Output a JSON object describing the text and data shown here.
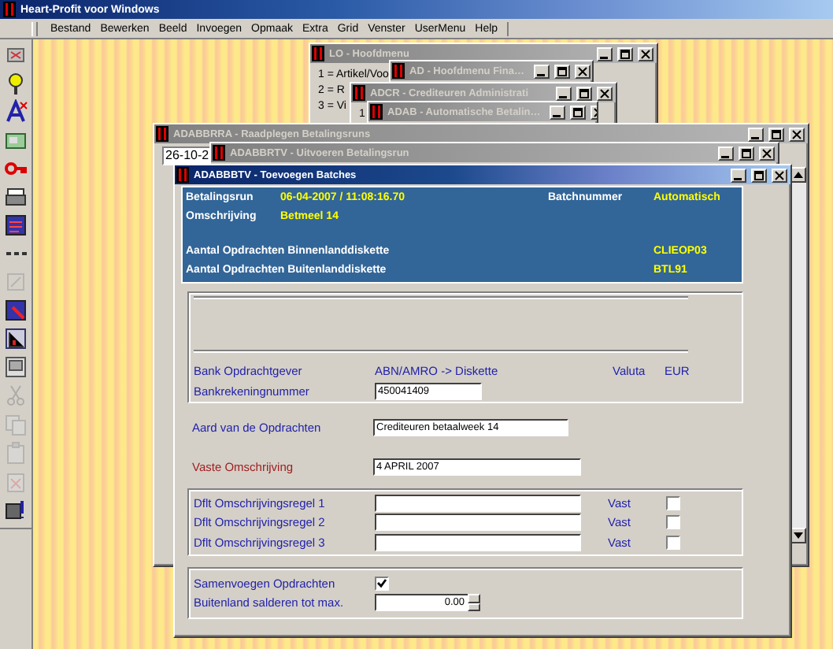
{
  "app": {
    "title": "Heart-Profit voor Windows"
  },
  "menu": [
    "Bestand",
    "Bewerken",
    "Beeld",
    "Invoegen",
    "Opmaak",
    "Extra",
    "Grid",
    "Venster",
    "UserMenu",
    "Help"
  ],
  "toolbar": [
    {
      "disabled": false
    },
    {
      "disabled": false
    },
    {
      "disabled": false
    },
    {
      "disabled": false
    },
    {
      "disabled": false
    },
    {
      "disabled": false
    },
    {
      "disabled": false
    },
    {
      "disabled": false
    },
    {
      "disabled": true
    },
    {
      "disabled": false
    },
    {
      "disabled": false
    },
    {
      "disabled": false
    },
    {
      "disabled": true
    },
    {
      "disabled": true
    },
    {
      "disabled": true
    },
    {
      "disabled": true
    },
    {
      "disabled": false
    }
  ],
  "windows": [
    {
      "kind": "menu",
      "title": "LO - Hoofdmenu",
      "active": false,
      "lines": [
        "1 = Artikel/Voo",
        "2 = R",
        "3 = Vi"
      ]
    },
    {
      "kind": "blank",
      "title": "AD - Hoofdmenu Fina…",
      "active": false
    },
    {
      "kind": "menu",
      "title": "ADCR - Crediteuren Administrati",
      "active": false,
      "lines": [
        "1"
      ]
    },
    {
      "kind": "blank",
      "title": "ADAB - Automatische Betalin…",
      "active": false
    },
    {
      "kind": "browse",
      "title": "ADABBRRA - Raadplegen Betalingsruns",
      "active": false,
      "field": "26-10-2"
    },
    {
      "kind": "blank",
      "title": "ADABBRTV - Uitvoeren Betalingsrun",
      "active": false
    },
    {
      "kind": "form",
      "title": "ADABBBTV - Toevoegen Batches",
      "active": true
    }
  ],
  "form": {
    "run": {
      "label": "Betalingsrun",
      "value": "06-04-2007 / 11:08:16.70",
      "batch_label": "Batchnummer",
      "batch": "Automatisch"
    },
    "description": {
      "label": "Omschrijving",
      "value": "Betmeel 14"
    },
    "diskettes": [
      {
        "label": "Aantal Opdrachten Binnenlanddiskette",
        "value": "CLIEOP03"
      },
      {
        "label": "Aantal Opdrachten Buitenlanddiskette",
        "value": "BTL91"
      }
    ],
    "bank": {
      "label": "Bank Opdrachtgever",
      "value": "ABN/AMRO -> Diskette",
      "currency_label": "Valuta",
      "currency": "EUR"
    },
    "account": {
      "label": "Bankrekeningnummer",
      "value": "450041409"
    },
    "nature": {
      "label": "Aard van de Opdrachten",
      "value": "Crediteuren betaalweek 14",
      "required": false
    },
    "fixed": {
      "label": "Vaste Omschrijving",
      "value": "4 APRIL 2007",
      "required": true
    },
    "default_lines": [
      {
        "label": "Dflt Omschrijvingsregel 1",
        "fixed_label": "Vast",
        "checked": false
      },
      {
        "label": "Dflt Omschrijvingsregel 2",
        "fixed_label": "Vast",
        "checked": false
      },
      {
        "label": "Dflt Omschrijvingsregel 3",
        "fixed_label": "Vast",
        "checked": false
      }
    ],
    "merge": {
      "label": "Samenvoegen Opdrachten",
      "checked": true
    },
    "balance": {
      "label": "Buitenland salderen tot max.",
      "value": "0.00"
    }
  }
}
